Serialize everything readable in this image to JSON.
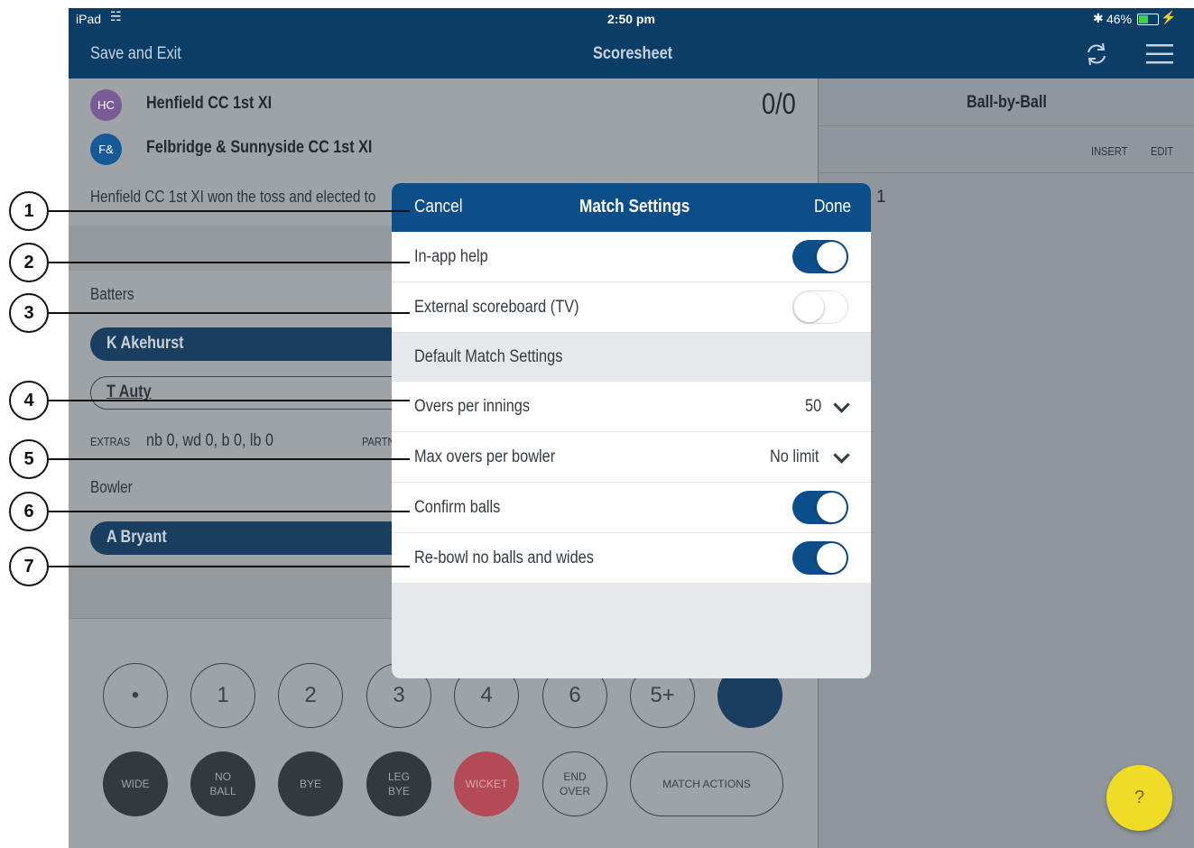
{
  "status_bar": {
    "device": "iPad",
    "time": "2:50 pm",
    "battery": "46%"
  },
  "nav": {
    "save_exit": "Save and Exit",
    "title": "Scoresheet",
    "sync_icon": "sync-icon",
    "menu_icon": "menu-icon"
  },
  "teams": [
    {
      "badge": "HC",
      "name": "Henfield CC 1st XI",
      "color": "#7b5b97"
    },
    {
      "badge": "F&",
      "name": "Felbridge & Sunnyside CC 1st XI",
      "color": "#155a96"
    }
  ],
  "score": "0/0",
  "toss_text": "Henfield CC 1st XI won the toss and elected to",
  "batters": {
    "label": "Batters",
    "striker": "K Akehurst",
    "non_striker": "T Auty"
  },
  "extras": {
    "label": "EXTRAS",
    "value": "nb 0, wd 0, b 0, lb 0",
    "partnership_label": "PARTN"
  },
  "bowler": {
    "label": "Bowler",
    "name": "A Bryant"
  },
  "run_buttons": [
    "•",
    "1",
    "2",
    "3",
    "4",
    "6",
    "5+"
  ],
  "action_buttons": {
    "wide": "WIDE",
    "no_ball": [
      "NO",
      "BALL"
    ],
    "bye": "BYE",
    "leg_bye": [
      "LEG",
      "BYE"
    ],
    "wicket": "WICKET",
    "end_over": [
      "END",
      "OVER"
    ],
    "match_actions": "MATCH ACTIONS"
  },
  "ball_by_ball": {
    "title": "Ball-by-Ball",
    "insert": "INSERT",
    "edit": "EDIT",
    "over_number": "1"
  },
  "help_button": "?",
  "modal": {
    "cancel": "Cancel",
    "title": "Match Settings",
    "done": "Done",
    "in_app_help": {
      "label": "In-app help",
      "on": true
    },
    "external_scoreboard": {
      "label": "External scoreboard (TV)",
      "on": false
    },
    "section_title": "Default Match Settings",
    "overs_per_innings": {
      "label": "Overs per innings",
      "value": "50"
    },
    "max_overs_per_bowler": {
      "label": "Max overs per bowler",
      "value": "No limit"
    },
    "confirm_balls": {
      "label": "Confirm balls",
      "on": true
    },
    "rebowl": {
      "label": "Re-bowl no balls and wides",
      "on": true
    }
  },
  "callouts": [
    "1",
    "2",
    "3",
    "4",
    "5",
    "6",
    "7"
  ],
  "colors": {
    "navy": "#0c3d67",
    "brand_blue": "#0c4e89",
    "wicket_red": "#b34a55",
    "help_yellow": "#f0dc24"
  }
}
